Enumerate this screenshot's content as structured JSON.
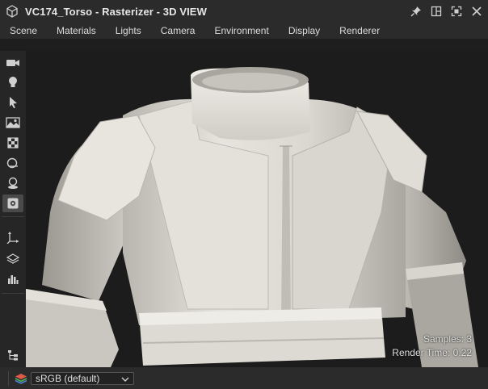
{
  "window": {
    "title": "VC174_Torso - Rasterizer - 3D VIEW"
  },
  "menu": {
    "items": [
      "Scene",
      "Materials",
      "Lights",
      "Camera",
      "Environment",
      "Display",
      "Renderer"
    ]
  },
  "toolbar": {
    "tools": [
      "camera-icon",
      "light-bulb-icon",
      "select-arrow-icon",
      "environment-map-icon",
      "tone-mapping-icon",
      "material-sphere-icon",
      "shadow-light-icon",
      "settings-icon"
    ],
    "active_tool": "settings-icon",
    "secondary_tools": [
      "axis-gizmo-icon",
      "layers-icon",
      "histogram-icon"
    ],
    "bottom_tool": "hierarchy-icon"
  },
  "viewport": {
    "samples_text": "Samples: 3",
    "render_time_text": "Render Time: 0.22"
  },
  "status": {
    "color_space": "sRGB (default)"
  },
  "colors": {
    "title_bg": "#2b2b2b",
    "viewport_bg": "#1c1c1c",
    "model": "#d9d7d0"
  }
}
